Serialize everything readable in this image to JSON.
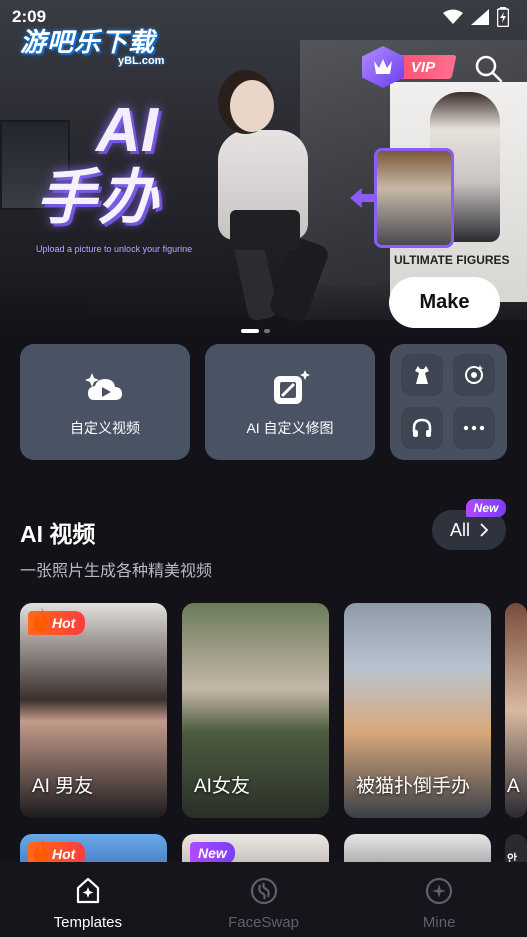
{
  "status_bar": {
    "time": "2:09"
  },
  "watermark": {
    "zh": "游吧乐下载",
    "en": "yBL.com"
  },
  "banner": {
    "title_line1": "AI",
    "title_line2": "手办",
    "subtitle": "Upload a picture to unlock your figurine",
    "box_label": "ULTIMATE FIGURES",
    "vip_label": "VIP",
    "make_label": "Make",
    "page_count": 2,
    "active_page": 0
  },
  "quick_actions": [
    {
      "label": "自定义视频",
      "icon": "video-plus-icon"
    },
    {
      "label": "AI 自定义修图",
      "icon": "magic-edit-icon"
    }
  ],
  "mini_tools": [
    {
      "icon": "dress-icon"
    },
    {
      "icon": "face-refresh-icon"
    },
    {
      "icon": "headphones-icon"
    },
    {
      "icon": "more-dots-icon"
    }
  ],
  "section": {
    "title": "AI 视频",
    "subtitle": "一张照片生成各种精美视频",
    "all_label": "All",
    "all_badge": "New"
  },
  "video_cards": [
    {
      "label": "AI 男友",
      "badge": "Hot"
    },
    {
      "label": "AI女友",
      "badge": ""
    },
    {
      "label": "被猫扑倒手办",
      "badge": ""
    },
    {
      "label": "A",
      "badge": ""
    }
  ],
  "next_row_badges": [
    "Hot",
    "New",
    "",
    ""
  ],
  "next_row_partial_text": "안이",
  "nav": {
    "items": [
      {
        "label": "Templates",
        "icon": "templates-icon",
        "active": true
      },
      {
        "label": "FaceSwap",
        "icon": "faceswap-icon",
        "active": false
      },
      {
        "label": "Mine",
        "icon": "mine-icon",
        "active": false
      }
    ]
  },
  "colors": {
    "background": "#121218",
    "card": "#4a5363",
    "accent_purple": "#8b5cf6",
    "hot_red": "#ff3d3d",
    "nav_inactive": "#5e606a"
  }
}
